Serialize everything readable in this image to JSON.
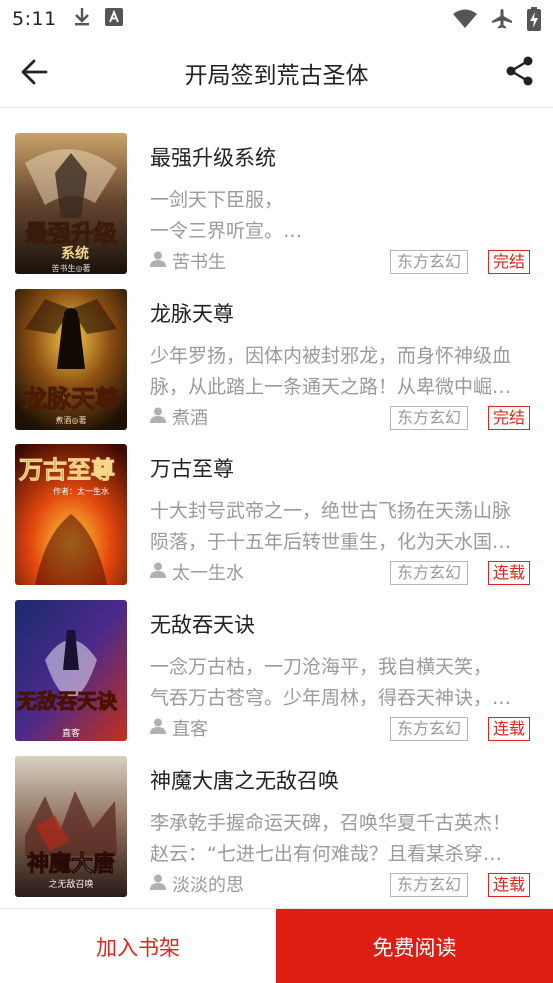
{
  "status_bar": {
    "time": "5:11",
    "icons_left": [
      "download-icon",
      "font-a-icon"
    ],
    "icons_right": [
      "wifi-icon",
      "airplane-icon",
      "battery-charging-icon"
    ]
  },
  "header": {
    "title": "开局签到荒古圣体",
    "back_icon": "arrow-left-icon",
    "share_icon": "share-icon"
  },
  "books": [
    {
      "title": "最强升级系统",
      "desc_lines": [
        "一剑天下臣服，",
        "一令三界听宣。…"
      ],
      "author": "苦书生",
      "genre": "东方玄幻",
      "status": "完结",
      "cover_title": "最强升级",
      "cover_sub": "系统",
      "cover_author": "苦书生◎著"
    },
    {
      "title": "龙脉天尊",
      "desc_lines": [
        "少年罗扬，因体内被封邪龙，而身怀神级血",
        "脉，从此踏上一条通天之路！从卑微中崛…"
      ],
      "author": "煮酒",
      "genre": "东方玄幻",
      "status": "完结",
      "cover_title": "龙脉天尊",
      "cover_sub": "",
      "cover_author": "煮酒◎著"
    },
    {
      "title": "万古至尊",
      "desc_lines": [
        "十大封号武帝之一，绝世古飞扬在天荡山脉",
        "陨落，于十五年后转世重生，化为天水国…"
      ],
      "author": "太一生水",
      "genre": "东方玄幻",
      "status": "连载",
      "cover_title": "万古至尊",
      "cover_sub": "",
      "cover_author": "作者：太一生水"
    },
    {
      "title": "无敌吞天诀",
      "desc_lines": [
        "一念万古枯，一刀沧海平，我自横天笑，",
        "气吞万古苍穹。少年周林，得吞天神诀，…"
      ],
      "author": "直客",
      "genre": "东方玄幻",
      "status": "连载",
      "cover_title": "无敌吞天诀",
      "cover_sub": "",
      "cover_author": "直客"
    },
    {
      "title": "神魔大唐之无敌召唤",
      "desc_lines": [
        "李承乾手握命运天碑，召唤华夏千古英杰！",
        "赵云：“七进七出有何难哉？且看某杀穿…"
      ],
      "author": "淡淡的思",
      "genre": "东方玄幻",
      "status": "连载",
      "cover_title": "神魔大唐",
      "cover_sub": "之无敌召唤",
      "cover_author": ""
    }
  ],
  "bottom_bar": {
    "add_shelf_label": "加入书架",
    "read_free_label": "免费阅读"
  },
  "colors": {
    "accent": "#dd1e12",
    "tag_border": "#b5b5b5",
    "secondary_text": "#9a9a9a"
  }
}
